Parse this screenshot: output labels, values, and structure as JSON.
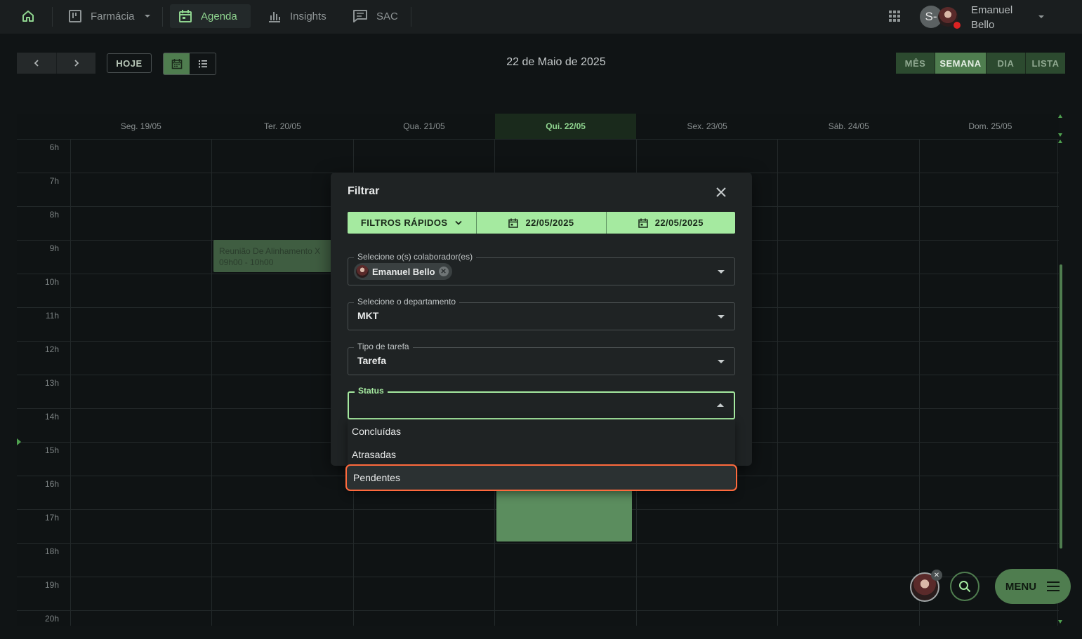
{
  "topbar": {
    "farmacia_label": "Farmácia",
    "agenda_label": "Agenda",
    "insights_label": "Insights",
    "sac_label": "SAC",
    "avatar_initial": "S-",
    "user_name": "Emanuel Bello"
  },
  "toolbar": {
    "today_label": "HOJE",
    "date_title": "22 de Maio de 2025",
    "modes": [
      "MÊS",
      "SEMANA",
      "DIA",
      "LISTA"
    ],
    "active_mode": "SEMANA"
  },
  "calendar": {
    "days": [
      "Seg. 19/05",
      "Ter. 20/05",
      "Qua. 21/05",
      "Qui. 22/05",
      "Sex. 23/05",
      "Sáb. 24/05",
      "Dom. 25/05"
    ],
    "today": "Qui. 22/05",
    "hours": [
      "6h",
      "7h",
      "8h",
      "9h",
      "10h",
      "11h",
      "12h",
      "13h",
      "14h",
      "15h",
      "16h",
      "17h",
      "18h",
      "19h",
      "20h"
    ],
    "event1": {
      "title": "Reunião De Alinhamento X",
      "time": "09h00 - 10h00"
    }
  },
  "modal": {
    "title": "Filtrar",
    "quick_filters_label": "FILTROS RÁPIDOS",
    "date_start": "22/05/2025",
    "date_end": "22/05/2025",
    "collaborator_label": "Selecione o(s) colaborador(es)",
    "collaborator_chip": "Emanuel Bello",
    "department_label": "Selecione o departamento",
    "department_value": "MKT",
    "task_type_label": "Tipo de tarefa",
    "task_type_value": "Tarefa",
    "status_label": "Status",
    "status_value": ""
  },
  "status_options": [
    "Concluídas",
    "Atrasadas",
    "Pendentes"
  ],
  "highlighted_option": "Pendentes",
  "fab": {
    "menu_label": "MENU"
  },
  "colors": {
    "accent": "#a5eaa0",
    "primary": "#4f7d4f",
    "highlight": "#ff6a3d",
    "background": "#101415"
  }
}
